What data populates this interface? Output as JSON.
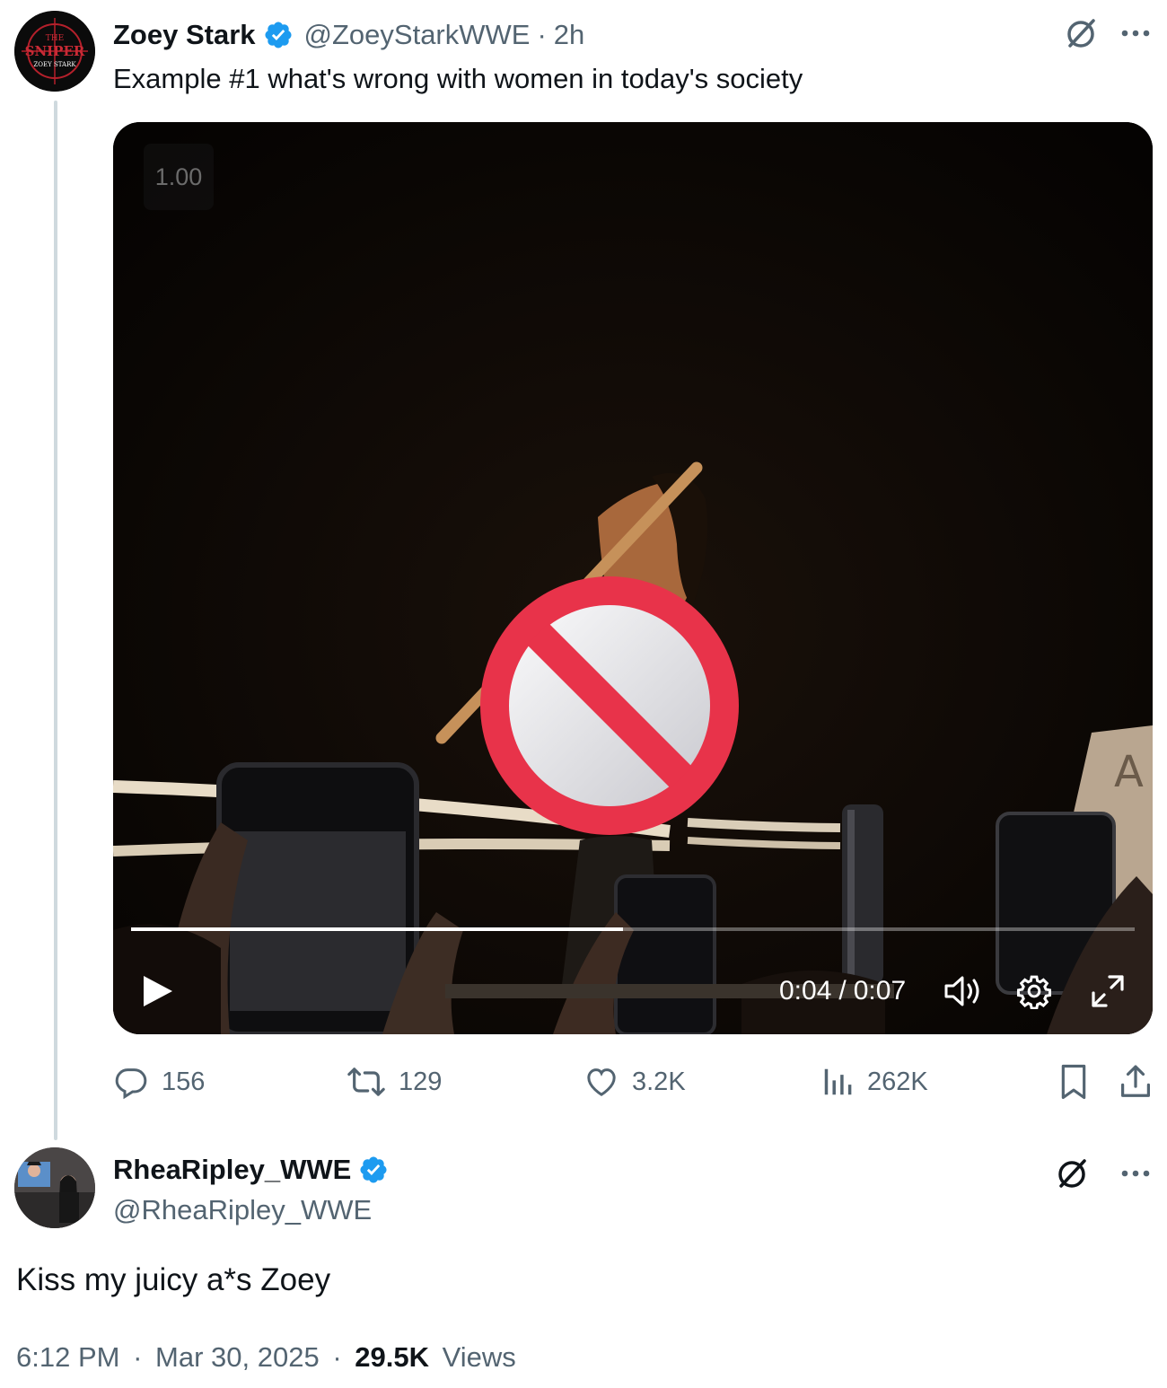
{
  "tweet1": {
    "avatar_label": "THE SNIPER ZOEY STARK",
    "name": "Zoey Stark",
    "handle": "@ZoeyStarkWWE",
    "separator": "·",
    "time": "2h",
    "text": "Example #1 what's wrong with women in today's society",
    "video": {
      "speed_badge": "1.00",
      "current_time": "0:04",
      "time_separator": "/",
      "duration": "0:07",
      "progress_fraction": 0.49,
      "overlay_icon": "prohibited-icon",
      "sign_text": "A"
    },
    "actions": {
      "replies": "156",
      "reposts": "129",
      "likes": "3.2K",
      "views": "262K"
    }
  },
  "tweet2": {
    "name": "RheaRipley_WWE",
    "handle": "@RheaRipley_WWE",
    "text": "Kiss my juicy a*s Zoey",
    "time": "6:12 PM",
    "separator": "·",
    "date": "Mar 30, 2025",
    "views_count": "29.5K",
    "views_label": "Views"
  },
  "colors": {
    "verified": "#1d9bf0",
    "muted": "#536471",
    "text": "#0f1419",
    "prohibited_red": "#e8334a"
  }
}
